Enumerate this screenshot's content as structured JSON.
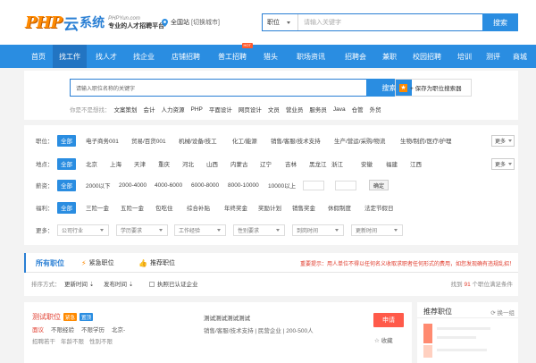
{
  "header": {
    "logo_php": "PHP",
    "logo_cloud": "云",
    "logo_name": "系统",
    "logo_site": "PHPYun.com",
    "logo_slogan": "专业的人才招聘平台",
    "location": "全国站",
    "switch_city": "[切换城市]",
    "search_category": "职位",
    "search_placeholder": "请输入关键字",
    "search_button": "搜索"
  },
  "nav": {
    "items": [
      "首页",
      "找工作",
      "找人才",
      "找企业",
      "店铺招聘",
      "普工招聘",
      "猎头",
      "职场资讯",
      "招聘会",
      "兼职",
      "校园招聘",
      "培训",
      "测评",
      "商城"
    ],
    "hot_badge": "HOT"
  },
  "job_search": {
    "placeholder": "请输入职位名称的关键字",
    "button": "搜索",
    "save_label": "+ 保存为职位搜索器",
    "hot_label": "你是不是想找：",
    "hot_keywords": [
      "文案策划",
      "会计",
      "人力资源",
      "PHP",
      "平面设计",
      "网页设计",
      "文员",
      "营业员",
      "服务员",
      "Java",
      "仓管",
      "外贸"
    ]
  },
  "filters": {
    "all_label": "全部",
    "more_label": "更多",
    "confirm_label": "确定",
    "job": {
      "label": "职位：",
      "options": [
        "电子商务001",
        "贸易/百货001",
        "机械/设备/技工",
        "化工/能源",
        "销售/客服/技术支持",
        "生产/营运/采购/物流",
        "生物/制药/医疗/护理"
      ]
    },
    "area": {
      "label": "地点：",
      "options": [
        "北京",
        "上海",
        "天津",
        "重庆",
        "河北",
        "山西",
        "内蒙古",
        "辽宁",
        "吉林",
        "黑龙江",
        "浙江",
        "安徽",
        "福建",
        "江西"
      ]
    },
    "salary": {
      "label": "薪资：",
      "options": [
        "2000以下",
        "2000-4000",
        "4000-6000",
        "6000-8000",
        "8000-10000",
        "10000以上"
      ]
    },
    "welfare": {
      "label": "福利：",
      "options": [
        "三险一金",
        "五险一金",
        "包吃住",
        "综合补贴",
        "年终奖金",
        "奖励计划",
        "销售奖金",
        "休假制度",
        "法定节假日"
      ]
    },
    "more_filters": {
      "label": "更多：",
      "selects": [
        "公司行业",
        "学历要求",
        "工作经验",
        "性别要求",
        "到岗时间",
        "更新时间"
      ]
    }
  },
  "results": {
    "tab_all": "所有职位",
    "tab_urgent": "紧急职位",
    "tab_recommend": "推荐职位",
    "notice": "重要提示：用人单位不得以任何名义收取求职者任何形式的费用，如您发现确有违规乱招！",
    "sort_label": "排序方式：",
    "sort_update": "更新时间",
    "sort_publish": "发布时间",
    "verified_only": "执照已认证企业",
    "found_prefix": "找到",
    "found_count": "91",
    "found_suffix": "个职位满足条件"
  },
  "job": {
    "title": "测试职位",
    "badge_urgent": "紧急",
    "badge_top": "置顶",
    "salary": "面议",
    "experience": "不限经验",
    "education": "不限学历",
    "city": "北京-",
    "update": "招聘若干",
    "welfare": "年龄不限",
    "gender": "性别不限",
    "company": "测试测试测试测试",
    "company_meta": "销售/客服/技术支持 | 民营企业 | 200-500人",
    "apply_button": "申请",
    "fav_button": "收藏"
  },
  "sidebar": {
    "title": "推荐职位",
    "swap": "换一组"
  },
  "colors": {
    "primary": "#2a8de1",
    "nav_active": "#2274c2",
    "accent_orange": "#ff8a00",
    "danger": "#e03b2c"
  }
}
